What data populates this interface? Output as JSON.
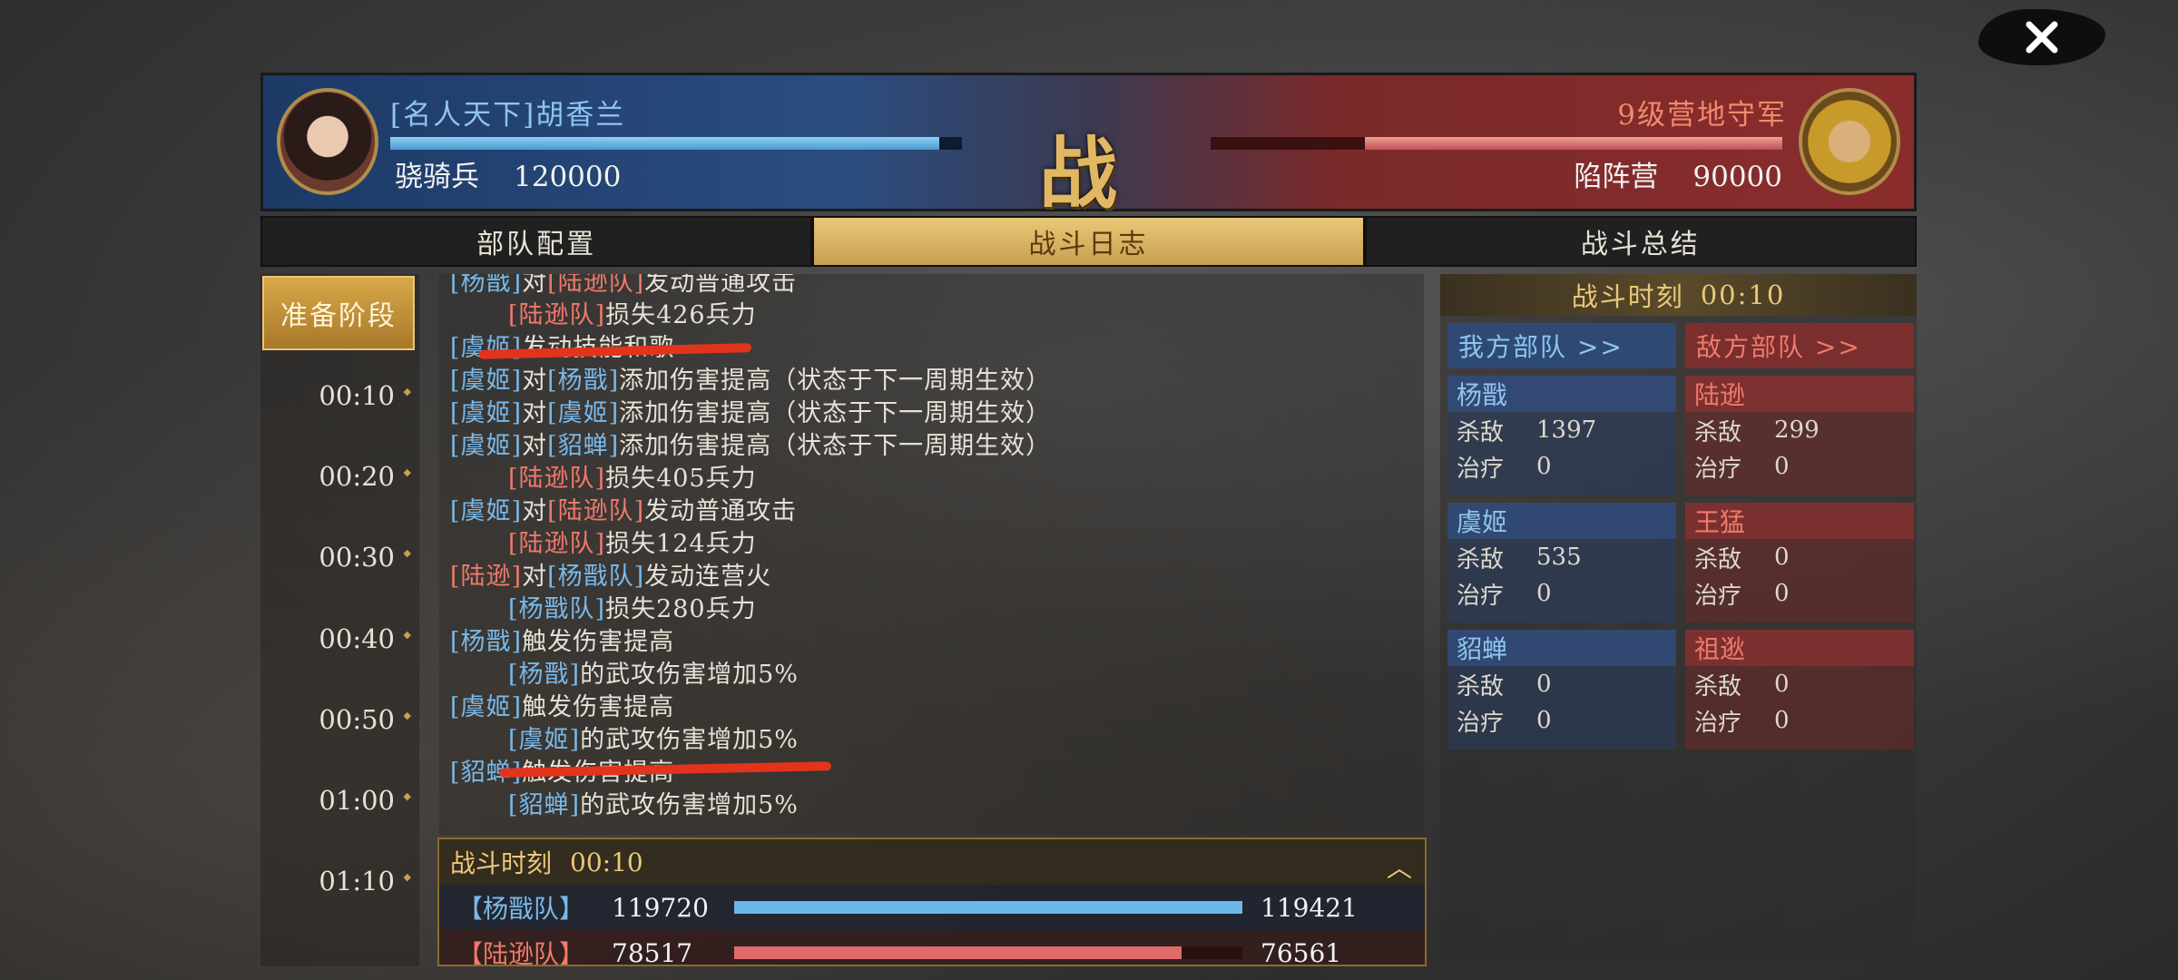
{
  "header": {
    "left_name": "[名人天下]胡香兰",
    "left_troop_type": "骁骑兵",
    "left_troop_count": "120000",
    "left_bar_fraction": 0.96,
    "right_name": "9级营地守军",
    "right_troop_type": "陷阵营",
    "right_troop_count": "90000",
    "right_bar_fraction": 0.73,
    "center_glyph": "战"
  },
  "tabs": [
    "部队配置",
    "战斗日志",
    "战斗总结"
  ],
  "timeline": {
    "phase": "准备阶段",
    "times": [
      "00:10",
      "00:20",
      "00:30",
      "00:40",
      "00:50",
      "01:00",
      "01:10"
    ]
  },
  "log": [
    {
      "indent": false,
      "parts": [
        [
          "b",
          "[杨戬]"
        ],
        [
          "n",
          "对"
        ],
        [
          "r",
          "[陆逊队]"
        ],
        [
          "n",
          "发动普通攻击"
        ]
      ]
    },
    {
      "indent": true,
      "parts": [
        [
          "r",
          "[陆逊队]"
        ],
        [
          "n",
          "损失426兵力"
        ]
      ]
    },
    {
      "indent": false,
      "parts": [
        [
          "b",
          "[虞姬]"
        ],
        [
          "n",
          "发动技能和歌"
        ]
      ]
    },
    {
      "indent": false,
      "parts": [
        [
          "b",
          "[虞姬]"
        ],
        [
          "n",
          "对"
        ],
        [
          "b",
          "[杨戬]"
        ],
        [
          "n",
          "添加伤害提高（状态于下一周期生效）"
        ]
      ]
    },
    {
      "indent": false,
      "parts": [
        [
          "b",
          "[虞姬]"
        ],
        [
          "n",
          "对"
        ],
        [
          "b",
          "[虞姬]"
        ],
        [
          "n",
          "添加伤害提高（状态于下一周期生效）"
        ]
      ]
    },
    {
      "indent": false,
      "parts": [
        [
          "b",
          "[虞姬]"
        ],
        [
          "n",
          "对"
        ],
        [
          "b",
          "[貂蝉]"
        ],
        [
          "n",
          "添加伤害提高（状态于下一周期生效）"
        ]
      ]
    },
    {
      "indent": true,
      "parts": [
        [
          "r",
          "[陆逊队]"
        ],
        [
          "n",
          "损失405兵力"
        ]
      ]
    },
    {
      "indent": false,
      "parts": [
        [
          "b",
          "[虞姬]"
        ],
        [
          "n",
          "对"
        ],
        [
          "r",
          "[陆逊队]"
        ],
        [
          "n",
          "发动普通攻击"
        ]
      ]
    },
    {
      "indent": true,
      "parts": [
        [
          "r",
          "[陆逊队]"
        ],
        [
          "n",
          "损失124兵力"
        ]
      ]
    },
    {
      "indent": false,
      "parts": [
        [
          "r",
          "[陆逊]"
        ],
        [
          "n",
          "对"
        ],
        [
          "b",
          "[杨戬队]"
        ],
        [
          "n",
          "发动连营火"
        ]
      ]
    },
    {
      "indent": true,
      "parts": [
        [
          "b",
          "[杨戬队]"
        ],
        [
          "n",
          "损失280兵力"
        ]
      ]
    },
    {
      "indent": false,
      "parts": [
        [
          "b",
          "[杨戬]"
        ],
        [
          "n",
          "触发伤害提高"
        ]
      ]
    },
    {
      "indent": true,
      "parts": [
        [
          "b",
          "[杨戬]"
        ],
        [
          "n",
          "的武攻伤害增加5%"
        ]
      ]
    },
    {
      "indent": false,
      "parts": [
        [
          "b",
          "[虞姬]"
        ],
        [
          "n",
          "触发伤害提高"
        ]
      ]
    },
    {
      "indent": true,
      "parts": [
        [
          "b",
          "[虞姬]"
        ],
        [
          "n",
          "的武攻伤害增加5%"
        ]
      ]
    },
    {
      "indent": false,
      "parts": [
        [
          "b",
          "[貂蝉]"
        ],
        [
          "n",
          "触发伤害提高"
        ]
      ]
    },
    {
      "indent": true,
      "parts": [
        [
          "b",
          "[貂蝉]"
        ],
        [
          "n",
          "的武攻伤害增加5%"
        ]
      ]
    }
  ],
  "summary": {
    "title": "战斗时刻",
    "time": "00:10",
    "rows": [
      {
        "name": "【杨戬队】",
        "v1": "119720",
        "v2": "119421",
        "fraction": 1.0,
        "color": "#6ab8e8",
        "side": "blue"
      },
      {
        "name": "【陆逊队】",
        "v1": "78517",
        "v2": "76561",
        "fraction": 0.88,
        "color": "#e06a6a",
        "side": "red"
      }
    ]
  },
  "stats": {
    "title": "战斗时刻",
    "time": "00:10",
    "ally_header": "我方部队 >>",
    "enemy_header": "敌方部队 >>",
    "kill_label": "杀敌",
    "heal_label": "治疗",
    "ally": [
      {
        "name": "杨戬",
        "kill": "1397",
        "heal": "0"
      },
      {
        "name": "虞姬",
        "kill": "535",
        "heal": "0"
      },
      {
        "name": "貂蝉",
        "kill": "0",
        "heal": "0"
      }
    ],
    "enemy": [
      {
        "name": "陆逊",
        "kill": "299",
        "heal": "0"
      },
      {
        "name": "王猛",
        "kill": "0",
        "heal": "0"
      },
      {
        "name": "祖逖",
        "kill": "0",
        "heal": "0"
      }
    ]
  },
  "colors": {
    "ally": "#79b9ea",
    "enemy": "#f07a6a",
    "accent": "#e8c878",
    "annotation": "#e2341c"
  }
}
